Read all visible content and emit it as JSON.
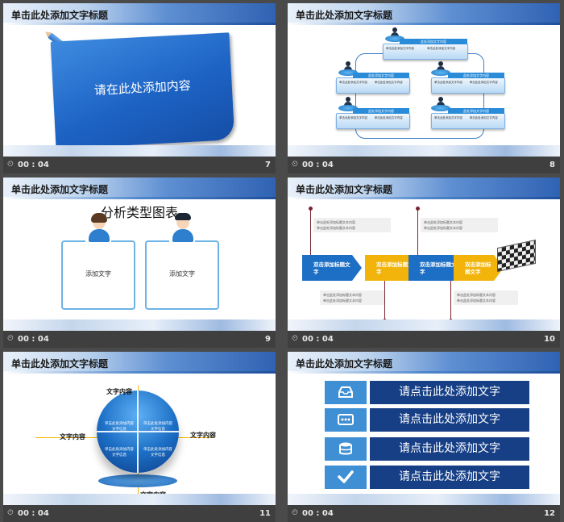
{
  "slides": [
    {
      "number": "7",
      "time": "00 : 04",
      "header_title": "单击此处添加文字标题",
      "content_text": "请在此处添加内容"
    },
    {
      "number": "8",
      "time": "00 : 04",
      "header_title": "单击此处添加文字标题",
      "node_header": "此处添加文字内容",
      "node_text": "单击此处添加文字内容"
    },
    {
      "number": "9",
      "time": "00 : 04",
      "header_title": "单击此处添加文字标题",
      "chart_heading": "分析类型图表",
      "panel_left_label": "添加文字",
      "panel_right_label": "添加文字"
    },
    {
      "number": "10",
      "time": "00 : 04",
      "header_title": "单击此处添加文字标题",
      "arrow_blue_text": "双击添加标题文字",
      "arrow_yellow_text": "双击添加标题文字",
      "note_text": "单击此处添加标题文本内容"
    },
    {
      "number": "11",
      "time": "00 : 04",
      "header_title": "单击此处添加文字标题",
      "label_top": "文字内容",
      "label_left": "文字内容",
      "label_right": "文字内容",
      "label_bottom": "文字内容",
      "quadrant_text": "单击此处添加内容文字信息"
    },
    {
      "number": "12",
      "time": "00 : 04",
      "header_title": "单击此处添加文字标题",
      "rows": [
        {
          "icon": "inbox-icon",
          "label": "请点击此处添加文字"
        },
        {
          "icon": "card-icon",
          "label": "请点击此处添加文字"
        },
        {
          "icon": "database-icon",
          "label": "请点击此处添加文字"
        },
        {
          "icon": "checkmark-icon",
          "label": "请点击此处添加文字"
        }
      ]
    }
  ],
  "colors": {
    "background": "#4a4a4a",
    "slide_blue": "#1d6fc6",
    "accent_yellow": "#f2b40a",
    "row_dark_blue": "#163f86"
  }
}
